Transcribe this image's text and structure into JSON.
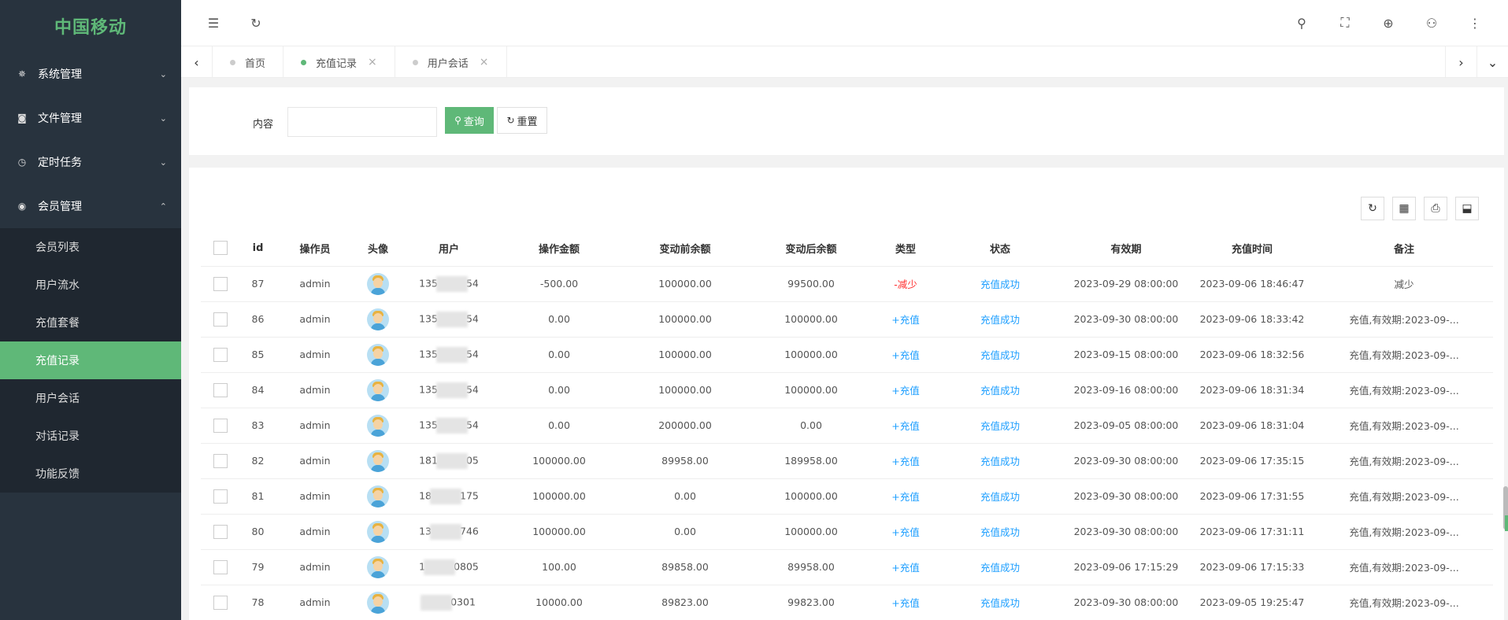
{
  "app": {
    "logo": "中国移动"
  },
  "sidebar": {
    "groups": [
      {
        "label": "系统管理",
        "icon": "gear-icon",
        "glyph": "✵",
        "chev": "⌄"
      },
      {
        "label": "文件管理",
        "icon": "camera-icon",
        "glyph": "◙",
        "chev": "⌄"
      },
      {
        "label": "定时任务",
        "icon": "clock-icon",
        "glyph": "◷",
        "chev": "⌄"
      },
      {
        "label": "会员管理",
        "icon": "member-icon",
        "glyph": "◉",
        "chev": "⌃"
      }
    ],
    "subitems": [
      "会员列表",
      "用户流水",
      "充值套餐",
      "充值记录",
      "用户会话",
      "对话记录",
      "功能反馈"
    ],
    "active_sub": "充值记录"
  },
  "header": {
    "icons": {
      "menu": "☰",
      "refresh": "↻",
      "search": "⚲",
      "fullscreen": "⛶",
      "globe": "⊕",
      "user": "⚇",
      "more": "⋮"
    }
  },
  "tabs": {
    "left_arrow": "‹",
    "right_arrow": "›",
    "dropdown": "⌄",
    "items": [
      {
        "label": "首页",
        "closable": false
      },
      {
        "label": "充值记录",
        "closable": true,
        "active": true
      },
      {
        "label": "用户会话",
        "closable": true
      }
    ],
    "close_glyph": "×"
  },
  "search": {
    "label": "内容",
    "value": "",
    "query_label": "查询",
    "reset_label": "重置",
    "query_icon": "⚲",
    "reset_icon": "↻"
  },
  "toolbar": {
    "refresh": "↻",
    "columns": "▦",
    "print": "⎙",
    "export": "⬓"
  },
  "table": {
    "columns": [
      "id",
      "操作员",
      "头像",
      "用户",
      "操作金额",
      "变动前余额",
      "变动后余额",
      "类型",
      "状态",
      "有效期",
      "充值时间",
      "备注"
    ],
    "rows": [
      {
        "id": "87",
        "operator": "admin",
        "user_pre": "135",
        "user_suf": "54",
        "amount": "-500.00",
        "before": "100000.00",
        "after": "99500.00",
        "type": "-减少",
        "type_kind": "red",
        "status": "充值成功",
        "expiry": "2023-09-29 08:00:00",
        "time": "2023-09-06 18:46:47",
        "note": "减少"
      },
      {
        "id": "86",
        "operator": "admin",
        "user_pre": "135",
        "user_suf": "54",
        "amount": "0.00",
        "before": "100000.00",
        "after": "100000.00",
        "type": "+充值",
        "type_kind": "blue",
        "status": "充值成功",
        "expiry": "2023-09-30 08:00:00",
        "time": "2023-09-06 18:33:42",
        "note": "充值,有效期:2023-09-..."
      },
      {
        "id": "85",
        "operator": "admin",
        "user_pre": "135",
        "user_suf": "54",
        "amount": "0.00",
        "before": "100000.00",
        "after": "100000.00",
        "type": "+充值",
        "type_kind": "blue",
        "status": "充值成功",
        "expiry": "2023-09-15 08:00:00",
        "time": "2023-09-06 18:32:56",
        "note": "充值,有效期:2023-09-..."
      },
      {
        "id": "84",
        "operator": "admin",
        "user_pre": "135",
        "user_suf": "54",
        "amount": "0.00",
        "before": "100000.00",
        "after": "100000.00",
        "type": "+充值",
        "type_kind": "blue",
        "status": "充值成功",
        "expiry": "2023-09-16 08:00:00",
        "time": "2023-09-06 18:31:34",
        "note": "充值,有效期:2023-09-..."
      },
      {
        "id": "83",
        "operator": "admin",
        "user_pre": "135",
        "user_suf": "54",
        "amount": "0.00",
        "before": "200000.00",
        "after": "0.00",
        "type": "+充值",
        "type_kind": "blue",
        "status": "充值成功",
        "expiry": "2023-09-05 08:00:00",
        "time": "2023-09-06 18:31:04",
        "note": "充值,有效期:2023-09-..."
      },
      {
        "id": "82",
        "operator": "admin",
        "user_pre": "181",
        "user_suf": "05",
        "amount": "100000.00",
        "before": "89958.00",
        "after": "189958.00",
        "type": "+充值",
        "type_kind": "blue",
        "status": "充值成功",
        "expiry": "2023-09-30 08:00:00",
        "time": "2023-09-06 17:35:15",
        "note": "充值,有效期:2023-09-..."
      },
      {
        "id": "81",
        "operator": "admin",
        "user_pre": "18",
        "user_suf": "175",
        "amount": "100000.00",
        "before": "0.00",
        "after": "100000.00",
        "type": "+充值",
        "type_kind": "blue",
        "status": "充值成功",
        "expiry": "2023-09-30 08:00:00",
        "time": "2023-09-06 17:31:55",
        "note": "充值,有效期:2023-09-..."
      },
      {
        "id": "80",
        "operator": "admin",
        "user_pre": "13",
        "user_suf": "746",
        "amount": "100000.00",
        "before": "0.00",
        "after": "100000.00",
        "type": "+充值",
        "type_kind": "blue",
        "status": "充值成功",
        "expiry": "2023-09-30 08:00:00",
        "time": "2023-09-06 17:31:11",
        "note": "充值,有效期:2023-09-..."
      },
      {
        "id": "79",
        "operator": "admin",
        "user_pre": "1",
        "user_suf": "0805",
        "amount": "100.00",
        "before": "89858.00",
        "after": "89958.00",
        "type": "+充值",
        "type_kind": "blue",
        "status": "充值成功",
        "expiry": "2023-09-06 17:15:29",
        "time": "2023-09-06 17:15:33",
        "note": "充值,有效期:2023-09-..."
      },
      {
        "id": "78",
        "operator": "admin",
        "user_pre": "",
        "user_suf": "0301",
        "amount": "10000.00",
        "before": "89823.00",
        "after": "99823.00",
        "type": "+充值",
        "type_kind": "blue",
        "status": "充值成功",
        "expiry": "2023-09-30 08:00:00",
        "time": "2023-09-05 19:25:47",
        "note": "充值,有效期:2023-09-..."
      }
    ]
  },
  "colors": {
    "accent": "#5fb878",
    "sidebar": "#28333e",
    "link_blue": "#1e9fff",
    "negative_red": "#ff2d2d"
  }
}
